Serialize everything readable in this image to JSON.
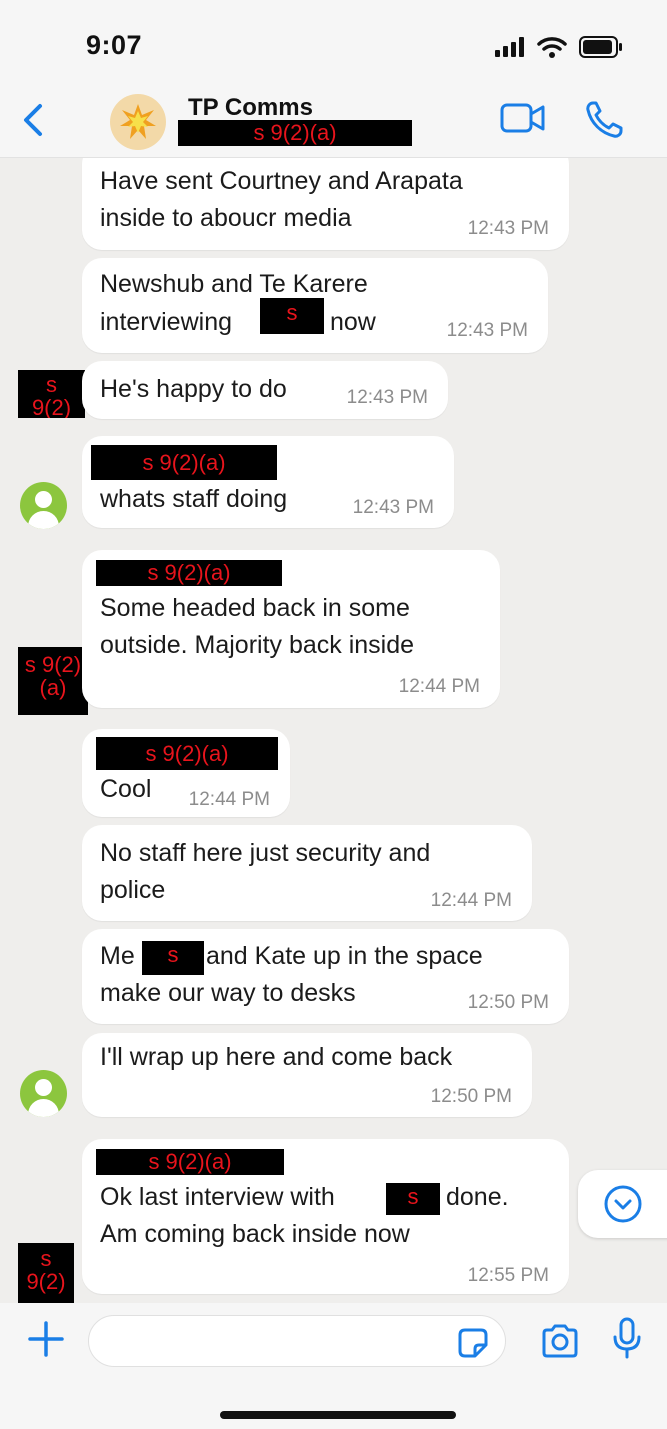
{
  "status": {
    "time": "9:07"
  },
  "header": {
    "title": "TP Comms",
    "subtitle_redaction": "s 9(2)(a)"
  },
  "colors": {
    "accent": "#1a7ee6",
    "avatar_green": "#8cc63e",
    "redaction_text": "#e8141c"
  },
  "messages": [
    {
      "text": "Have sent Courtney and Arapata\ninside to aboucr media",
      "time": "12:43 PM"
    },
    {
      "line1_a": "Newshub and Te Karere",
      "line2_a": "interviewing",
      "redaction": "s",
      "line2_b": "now",
      "time": "12:43 PM"
    },
    {
      "text": "He's happy to do",
      "time": "12:43 PM",
      "side_redaction": "s\n9(2)"
    },
    {
      "sender_redaction": "s 9(2)(a)",
      "text": "whats staff doing",
      "time": "12:43 PM"
    },
    {
      "sender_redaction": "s 9(2)(a)",
      "text": "Some headed back in some\noutside. Majority back inside",
      "time": "12:44 PM",
      "side_redaction": "s 9(2)\n(a)"
    },
    {
      "sender_redaction": "s 9(2)(a)",
      "text": "Cool",
      "time": "12:44 PM"
    },
    {
      "text": "No staff here just security and\npolice",
      "time": "12:44 PM"
    },
    {
      "line1_a": "Me",
      "redaction": "s",
      "line1_b": "and Kate up in the space",
      "line2": "make our way to desks",
      "time": "12:50 PM"
    },
    {
      "text": "I'll wrap up here and come back",
      "time": "12:50 PM"
    },
    {
      "sender_redaction": "s 9(2)(a)",
      "line1_a": "Ok last interview with",
      "redaction": "s",
      "line1_b": "done.",
      "line2": "Am coming back inside now",
      "time": "12:55 PM",
      "side_redaction": "s\n9(2)"
    }
  ],
  "composer": {
    "value": "",
    "placeholder": ""
  }
}
